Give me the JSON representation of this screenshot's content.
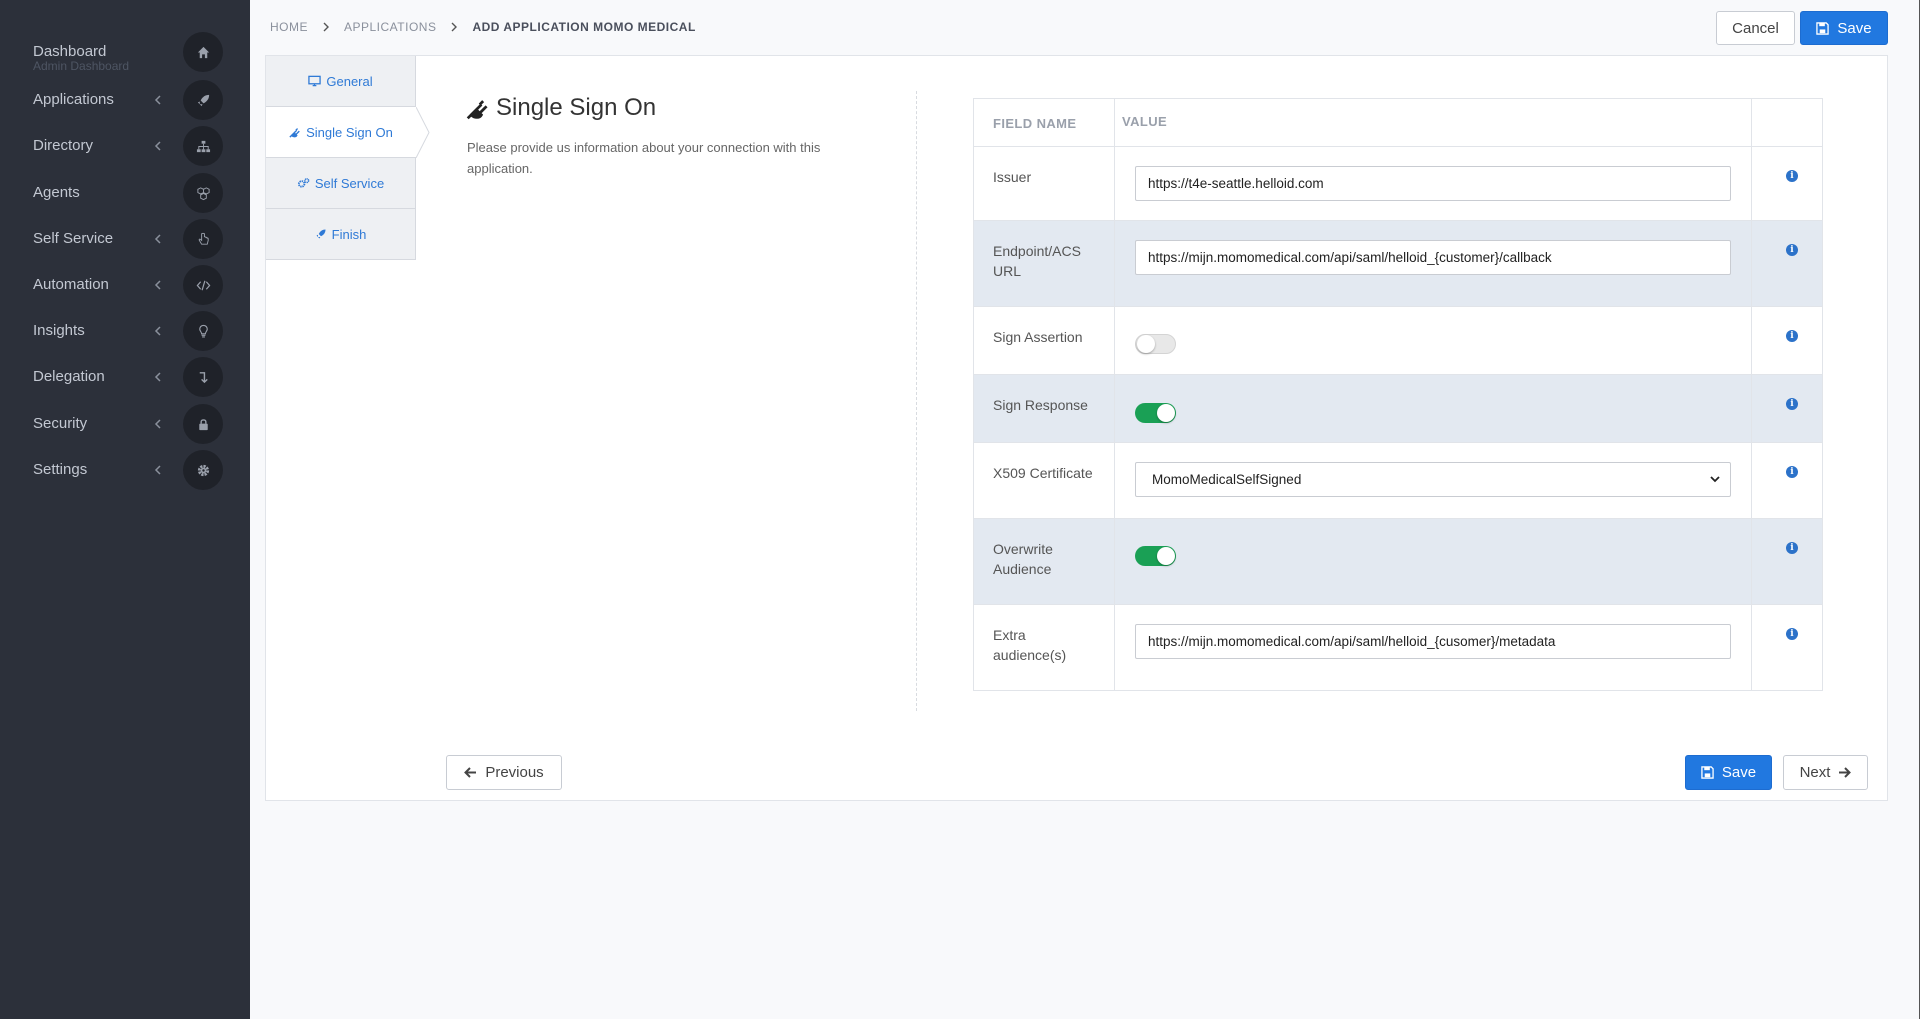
{
  "sidebar": {
    "items": [
      {
        "label": "Dashboard",
        "sub": "Admin Dashboard",
        "icon": "home-icon"
      },
      {
        "label": "Applications",
        "icon": "rocket-icon"
      },
      {
        "label": "Directory",
        "icon": "sitemap-icon"
      },
      {
        "label": "Agents",
        "icon": "cubes-icon"
      },
      {
        "label": "Self Service",
        "icon": "hand-pointer-icon"
      },
      {
        "label": "Automation",
        "icon": "code-icon"
      },
      {
        "label": "Insights",
        "icon": "lightbulb-icon"
      },
      {
        "label": "Delegation",
        "icon": "level-down-icon"
      },
      {
        "label": "Security",
        "icon": "lock-icon"
      },
      {
        "label": "Settings",
        "icon": "gear-icon"
      }
    ]
  },
  "breadcrumb": {
    "home": "HOME",
    "applications": "APPLICATIONS",
    "current": "ADD APPLICATION MOMO MEDICAL"
  },
  "top_actions": {
    "cancel": "Cancel",
    "save": "Save"
  },
  "steps": {
    "general": "General",
    "sso": "Single Sign On",
    "self_service": "Self Service",
    "finish": "Finish"
  },
  "section": {
    "title": "Single Sign On",
    "description": "Please provide us information about your connection with this application."
  },
  "table": {
    "headers": {
      "field": "FIELD NAME",
      "value": "VALUE"
    },
    "rows": [
      {
        "label": "Issuer",
        "value": "https://t4e-seattle.helloid.com"
      },
      {
        "label": "Endpoint/ACS URL",
        "value": "https://mijn.momomedical.com/api/saml/helloid_{customer}/callback"
      },
      {
        "label": "Sign Assertion",
        "toggle": "off"
      },
      {
        "label": "Sign Response",
        "toggle": "on"
      },
      {
        "label": "X509 Certificate",
        "value": "MomoMedicalSelfSigned"
      },
      {
        "label": "Overwrite Audience",
        "toggle": "on"
      },
      {
        "label": "Extra audience(s)",
        "value": "https://mijn.momomedical.com/api/saml/helloid_{cusomer}/metadata"
      }
    ]
  },
  "footer": {
    "previous": "Previous",
    "save": "Save",
    "next": "Next"
  },
  "colors": {
    "sidebar": "#2c303a",
    "primary": "#2178e0",
    "toggle_on": "#1aa055",
    "row_alt": "#e3e9f1"
  }
}
